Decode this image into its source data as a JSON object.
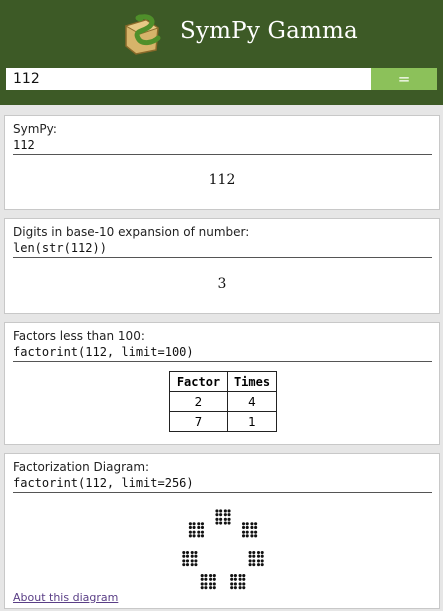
{
  "header": {
    "app_title": "SymPy Gamma",
    "logo_icon": "sympy-snake-logo-icon",
    "colors": {
      "header_bg": "#3d5a26",
      "button_bg": "#8cc15a"
    }
  },
  "search": {
    "value": "112",
    "submit_label": "="
  },
  "cards": [
    {
      "title": "SymPy:",
      "code": "112",
      "result": "112"
    },
    {
      "title": "Digits in base-10 expansion of number:",
      "code": "len(str(112))",
      "result": "3"
    },
    {
      "title": "Factors less than 100:",
      "code": "factorint(112, limit=100)",
      "table": {
        "headers": [
          "Factor",
          "Times"
        ],
        "rows": [
          [
            "2",
            "4"
          ],
          [
            "7",
            "1"
          ]
        ]
      }
    },
    {
      "title": "Factorization Diagram:",
      "code": "factorint(112, limit=256)",
      "link": "About this diagram"
    }
  ]
}
